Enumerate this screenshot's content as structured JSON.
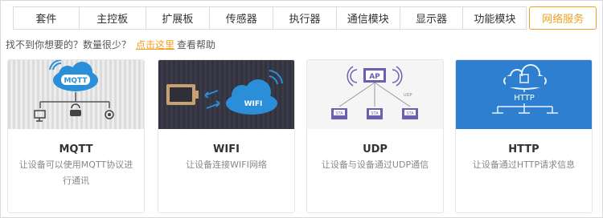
{
  "tabs": [
    {
      "label": "套件"
    },
    {
      "label": "主控板"
    },
    {
      "label": "扩展板"
    },
    {
      "label": "传感器"
    },
    {
      "label": "执行器"
    },
    {
      "label": "通信模块"
    },
    {
      "label": "显示器"
    },
    {
      "label": "功能模块"
    },
    {
      "label": "网络服务",
      "active": true
    }
  ],
  "hint": {
    "prefix": "找不到你想要的？数量很少？",
    "link": "点击这里",
    "suffix": "查看帮助"
  },
  "cards": [
    {
      "title": "MQTT",
      "desc": "让设备可以使用MQTT协议进行通讯",
      "image_label": "MQTT"
    },
    {
      "title": "WIFI",
      "desc": "让设备连接WIFI网络",
      "image_label": "WIFI"
    },
    {
      "title": "UDP",
      "desc": "让设备与设备通过UDP通信",
      "image_label": "AP",
      "sta_label": "STA",
      "udp_label": "UDP"
    },
    {
      "title": "HTTP",
      "desc": "让设备通过HTTP请求信息",
      "image_label": "HTTP"
    }
  ],
  "colors": {
    "accent": "#f0a020",
    "http_bg": "#2f7fd0",
    "wifi_bg": "#3a3a48",
    "udp_purple": "#6b5fb0"
  }
}
